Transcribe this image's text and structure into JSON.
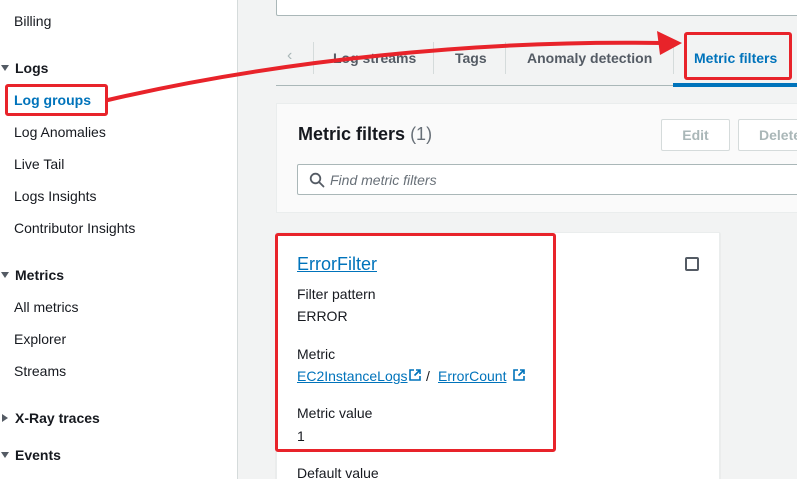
{
  "sidebar": {
    "billing": "Billing",
    "logs_section": "Logs",
    "log_groups": "Log groups",
    "log_anomalies": "Log Anomalies",
    "live_tail": "Live Tail",
    "logs_insights": "Logs Insights",
    "contributor_insights": "Contributor Insights",
    "metrics_section": "Metrics",
    "all_metrics": "All metrics",
    "explorer": "Explorer",
    "streams": "Streams",
    "xray_section": "X-Ray traces",
    "events_section": "Events"
  },
  "tabs": {
    "log_streams": "Log streams",
    "tags": "Tags",
    "anomaly_detection": "Anomaly detection",
    "metric_filters": "Metric filters"
  },
  "metric_filters_panel": {
    "title": "Metric filters",
    "count": "(1)",
    "edit_button": "Edit",
    "delete_button": "Delete",
    "search_placeholder": "Find metric filters"
  },
  "filter": {
    "name": "ErrorFilter",
    "filter_pattern_label": "Filter pattern",
    "filter_pattern_value": "ERROR",
    "metric_label": "Metric",
    "metric_namespace": "EC2InstanceLogs",
    "metric_separator": "/",
    "metric_name": "ErrorCount",
    "metric_value_label": "Metric value",
    "metric_value": "1",
    "default_value_label": "Default value"
  },
  "colors": {
    "link": "#0073bb",
    "annotation": "#e8232a"
  }
}
